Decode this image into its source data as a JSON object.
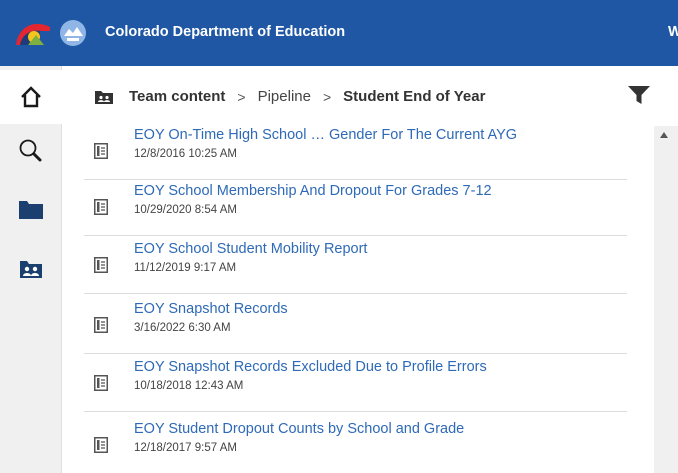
{
  "header": {
    "brand": "Colorado Department of Education",
    "overflow_text": "W"
  },
  "breadcrumb": {
    "items": [
      {
        "label": "Team content",
        "bold": true
      },
      {
        "label": "Pipeline",
        "bold": false
      },
      {
        "label": "Student End of Year",
        "bold": true
      }
    ],
    "separator": ">"
  },
  "sidebar": {
    "items": [
      {
        "icon": "home-icon"
      },
      {
        "icon": "search-icon"
      },
      {
        "icon": "folder-icon"
      },
      {
        "icon": "team-folder-icon"
      }
    ]
  },
  "reports": [
    {
      "title": "EOY On-Time High School … Gender For The Current AYG",
      "date": "12/8/2016 10:25 AM"
    },
    {
      "title": "EOY School Membership And Dropout For Grades 7-12",
      "date": "10/29/2020 8:54 AM"
    },
    {
      "title": "EOY School Student Mobility Report",
      "date": "11/12/2019 9:17 AM"
    },
    {
      "title": "EOY Snapshot Records",
      "date": "3/16/2022 6:30 AM"
    },
    {
      "title": "EOY Snapshot Records Excluded Due to Profile Errors",
      "date": "10/18/2018 12:43 AM"
    },
    {
      "title": "EOY Student Dropout Counts by School and Grade",
      "date": "12/18/2017 9:57 AM"
    }
  ],
  "colors": {
    "topbar": "#1f57a5",
    "link": "#2e6ab7",
    "nav_icon": "#1b3f6e"
  }
}
